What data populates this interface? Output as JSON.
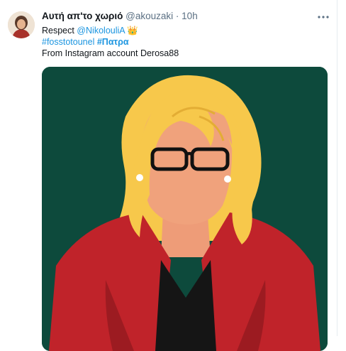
{
  "tweet": {
    "display_name": "Αυτή απ'το χωριό",
    "handle": "@akouzaki",
    "separator": "·",
    "time": "10h",
    "line1_prefix": "Respect ",
    "mention": "@NikolouliA",
    "line1_emoji": "👑",
    "hashtag1": "#fosstotounel",
    "hashtag2": "#Πατρα",
    "line3": "From Instagram account Derosa88"
  },
  "icons": {
    "avatar": "user-avatar-illustration",
    "more": "more-horizontal-icon",
    "crown": "crown-emoji"
  },
  "colors": {
    "link": "#1b95e0",
    "secondary_text": "#5b7083",
    "illustration_background": "#0d4a3c",
    "jacket": "#c0232a",
    "hair": "#f7c84b",
    "skin": "#f0a27c"
  }
}
